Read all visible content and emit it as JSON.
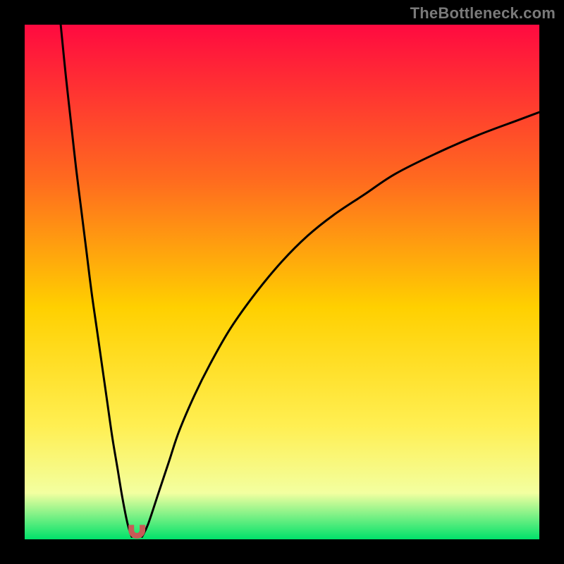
{
  "watermark": "TheBottleneck.com",
  "colors": {
    "frame": "#000000",
    "gradient_top": "#ff0a40",
    "gradient_mid1": "#ff6a1f",
    "gradient_mid2": "#ffd000",
    "gradient_mid3": "#ffef52",
    "gradient_mid4": "#f3ffa0",
    "gradient_bot": "#00e26a",
    "curve": "#000000",
    "marker_fill": "#c85a57",
    "marker_stroke": "#c85a57"
  },
  "chart_data": {
    "type": "line",
    "title": "",
    "xlabel": "",
    "ylabel": "",
    "xlim": [
      0,
      100
    ],
    "ylim": [
      0,
      100
    ],
    "series": [
      {
        "name": "left-curve",
        "x": [
          7,
          8,
          9,
          10,
          11,
          12,
          13,
          14,
          15,
          16,
          17,
          18,
          19,
          20,
          20.8
        ],
        "y": [
          100,
          90,
          81,
          72,
          64,
          56,
          48,
          41,
          34,
          27,
          20,
          14,
          8,
          3,
          0.5
        ]
      },
      {
        "name": "right-curve",
        "x": [
          22.8,
          24,
          26,
          28,
          30,
          33,
          36,
          40,
          45,
          50,
          55,
          60,
          66,
          72,
          80,
          88,
          96,
          100
        ],
        "y": [
          0.5,
          3,
          9,
          15,
          21,
          28,
          34,
          41,
          48,
          54,
          59,
          63,
          67,
          71,
          75,
          78.5,
          81.5,
          83
        ]
      }
    ],
    "marker": {
      "name": "U-marker",
      "x": 21.8,
      "y": 1.2,
      "width": 3.0,
      "height": 2.4
    }
  }
}
